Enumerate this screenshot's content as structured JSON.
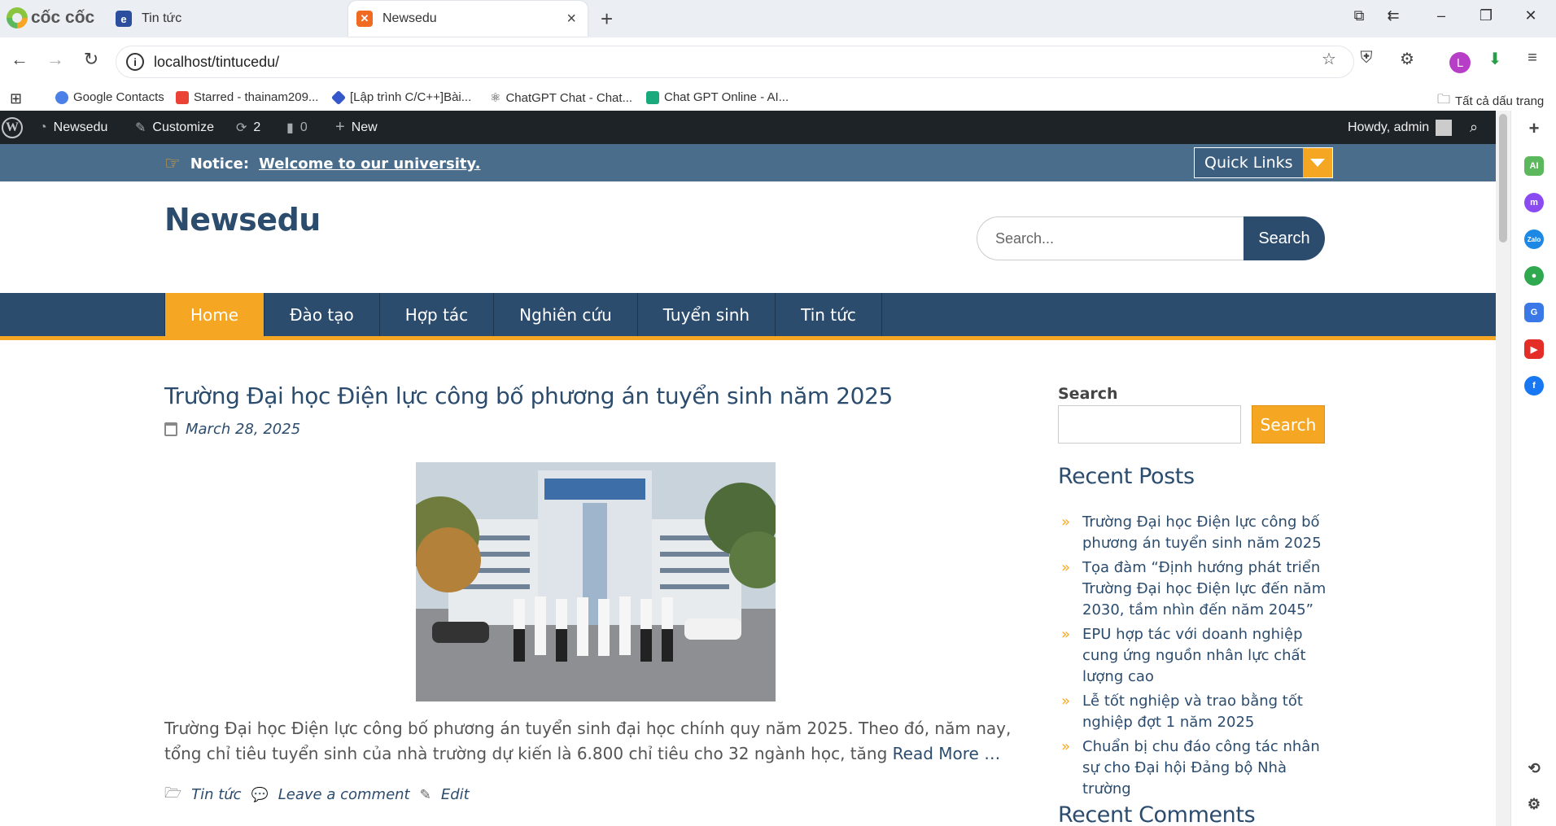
{
  "browser": {
    "brand": "cốc cốc",
    "tabs": [
      {
        "label": "Tin tức",
        "active": false
      },
      {
        "label": "Newsedu",
        "active": true
      }
    ],
    "url": "localhost/tintucedu/",
    "bookmarks": [
      {
        "label": "Google Contacts",
        "icon": "contacts-icon"
      },
      {
        "label": "Starred - thainam209...",
        "icon": "gmail-icon"
      },
      {
        "label": "[Lập trình C/C++]Bài...",
        "icon": "diamond-icon"
      },
      {
        "label": "ChatGPT Chat - Chat...",
        "icon": "atom-icon"
      },
      {
        "label": "Chat GPT Online - AI...",
        "icon": "bot-icon"
      }
    ],
    "all_bookmarks": "Tất cả dấu trang",
    "profile_initial": "L",
    "sidebar_icons": [
      "add-icon",
      "ai-icon",
      "messenger-icon",
      "zalo-icon",
      "game-icon",
      "translate-icon",
      "youtube-icon",
      "facebook-icon",
      "history-icon",
      "settings-icon"
    ]
  },
  "wp_admin_bar": {
    "site": "Newsedu",
    "customize": "Customize",
    "updates_count": "2",
    "comments_count": "0",
    "new": "New",
    "howdy": "Howdy, admin"
  },
  "notice": {
    "label": "Notice:",
    "text": "Welcome to our university.",
    "quick_links": "Quick Links"
  },
  "header": {
    "site_title": "Newsedu",
    "search_placeholder": "Search...",
    "search_button": "Search"
  },
  "nav": {
    "items": [
      "Home",
      "Đào tạo",
      "Hợp tác",
      "Nghiên cứu",
      "Tuyển sinh",
      "Tin tức"
    ],
    "active_index": 0
  },
  "post": {
    "title": "Trường Đại học Điện lực công bố phương án tuyển sinh năm 2025",
    "date": "March 28, 2025",
    "excerpt": "Trường Đại học Điện lực công bố phương án tuyển sinh đại học chính quy năm 2025. Theo đó, năm nay, tổng chỉ tiêu tuyển sinh của nhà trường dự kiến là 6.800 chỉ tiêu cho 32 ngành học, tăng",
    "read_more": "Read More …",
    "category": "Tin tức",
    "comment_link": "Leave a comment",
    "edit_link": "Edit"
  },
  "sidebar": {
    "search_label": "Search",
    "search_button": "Search",
    "recent_posts_title": "Recent Posts",
    "recent_posts": [
      "Trường Đại học Điện lực công bố phương án tuyển sinh năm 2025",
      "Tọa đàm “Định hướng phát triển Trường Đại học Điện lực đến năm 2030, tầm nhìn đến năm 2045”",
      "EPU hợp tác với doanh nghiệp cung ứng nguồn nhân lực chất lượng cao",
      "Lễ tốt nghiệp và trao bằng tốt nghiệp đợt 1 năm 2025",
      "Chuẩn bị chu đáo công tác nhân sự cho Đại hội Đảng bộ Nhà trường"
    ],
    "recent_comments_title": "Recent Comments"
  },
  "colors": {
    "primary": "#2c4c6e",
    "accent": "#f5a623",
    "notice_bar": "#4a6d8c",
    "admin_bar": "#1d2327"
  }
}
